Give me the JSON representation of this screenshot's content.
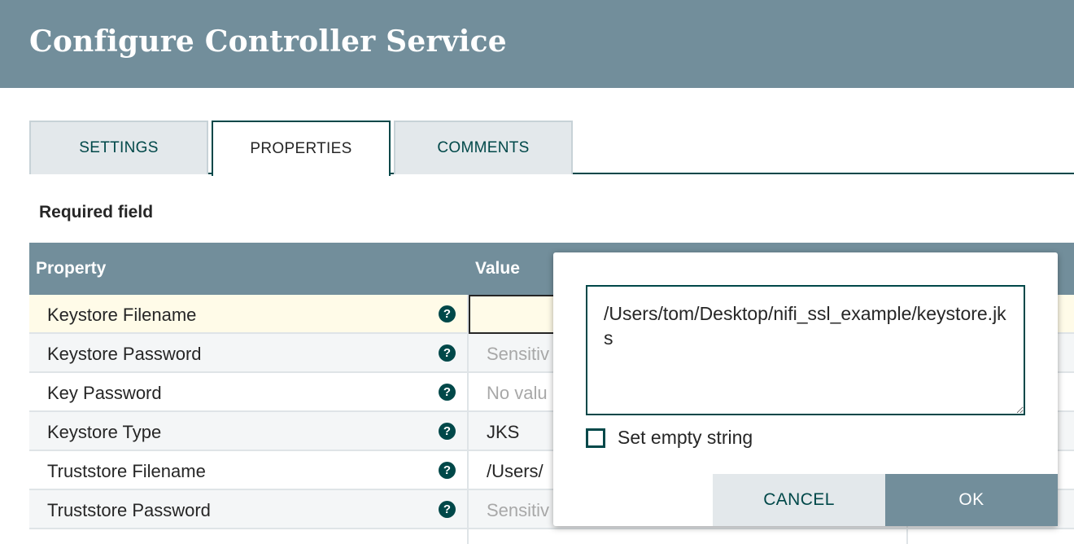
{
  "header": {
    "title": "Configure Controller Service"
  },
  "tabs": [
    {
      "label": "SETTINGS"
    },
    {
      "label": "PROPERTIES"
    },
    {
      "label": "COMMENTS"
    }
  ],
  "required_label": "Required field",
  "table": {
    "columns": {
      "property": "Property",
      "value": "Value"
    },
    "rows": [
      {
        "name": "Keystore Filename",
        "value": ""
      },
      {
        "name": "Keystore Password",
        "value": "Sensitiv"
      },
      {
        "name": "Key Password",
        "value": "No valu"
      },
      {
        "name": "Keystore Type",
        "value": "JKS"
      },
      {
        "name": "Truststore Filename",
        "value": "/Users/"
      },
      {
        "name": "Truststore Password",
        "value": "Sensitiv"
      }
    ],
    "help_glyph": "?"
  },
  "editor": {
    "value": "/Users/tom/Desktop/nifi_ssl_example/keystore.jks",
    "empty_string_label": "Set empty string",
    "cancel_label": "CANCEL",
    "ok_label": "OK"
  },
  "colors": {
    "header_bg": "#728e9b",
    "accent": "#004849",
    "active_row": "#fffbe8"
  }
}
